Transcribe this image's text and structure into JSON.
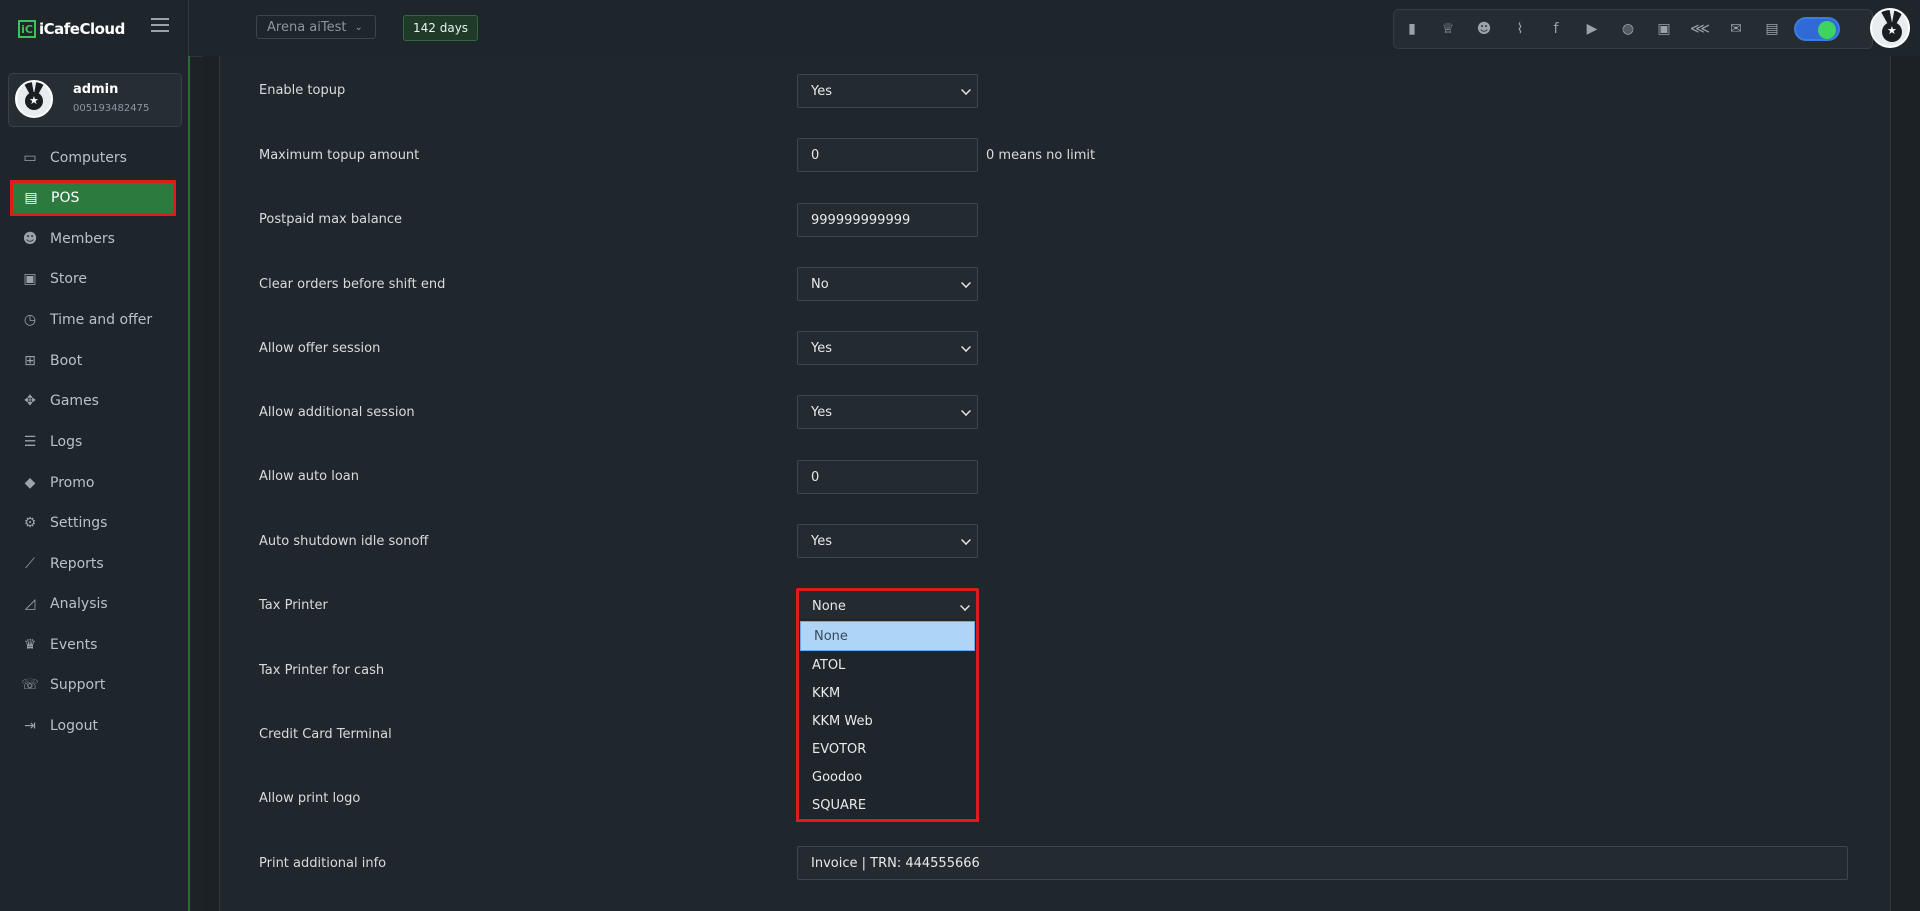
{
  "app": {
    "logo_text": "iCafeCloud",
    "logo_mark": "iC"
  },
  "user": {
    "name": "admin",
    "id": "005193482475"
  },
  "sidebar": {
    "items": [
      {
        "label": "Computers",
        "icon": "monitor-icon",
        "glyph": "▭"
      },
      {
        "label": "POS",
        "icon": "pos-icon",
        "glyph": "▤"
      },
      {
        "label": "Members",
        "icon": "members-icon",
        "glyph": "☻"
      },
      {
        "label": "Store",
        "icon": "store-icon",
        "glyph": "▣"
      },
      {
        "label": "Time and offer",
        "icon": "clock-icon",
        "glyph": "◷"
      },
      {
        "label": "Boot",
        "icon": "windows-icon",
        "glyph": "⊞"
      },
      {
        "label": "Games",
        "icon": "gamepad-icon",
        "glyph": "✥"
      },
      {
        "label": "Logs",
        "icon": "list-icon",
        "glyph": "☰"
      },
      {
        "label": "Promo",
        "icon": "tag-icon",
        "glyph": "◆"
      },
      {
        "label": "Settings",
        "icon": "gear-icon",
        "glyph": "⚙"
      },
      {
        "label": "Reports",
        "icon": "line-chart-icon",
        "glyph": "⟋"
      },
      {
        "label": "Analysis",
        "icon": "area-chart-icon",
        "glyph": "◿"
      },
      {
        "label": "Events",
        "icon": "crown-icon",
        "glyph": "♛"
      },
      {
        "label": "Support",
        "icon": "phone-icon",
        "glyph": "☏"
      },
      {
        "label": "Logout",
        "icon": "logout-icon",
        "glyph": "⇥"
      }
    ]
  },
  "topbar": {
    "cafe_name": "Arena aiTest",
    "days_left": "142 days",
    "icons": [
      "leaderboard-icon",
      "trophy-icon",
      "group-icon",
      "rss-icon",
      "facebook-icon",
      "youtube-icon",
      "globe-icon",
      "icafe-icon",
      "handshake-icon",
      "mail-icon",
      "chat-icon"
    ]
  },
  "settings": {
    "rows": [
      {
        "label": "Enable topup",
        "type": "select",
        "value": "Yes"
      },
      {
        "label": "Maximum topup amount",
        "type": "input",
        "value": "0",
        "hint": "0 means no limit"
      },
      {
        "label": "Postpaid max balance",
        "type": "input",
        "value": "999999999999"
      },
      {
        "label": "Clear orders before shift end",
        "type": "select",
        "value": "No"
      },
      {
        "label": "Allow offer session",
        "type": "select",
        "value": "Yes"
      },
      {
        "label": "Allow additional session",
        "type": "select",
        "value": "Yes"
      },
      {
        "label": "Allow auto loan",
        "type": "input",
        "value": "0"
      },
      {
        "label": "Auto shutdown idle sonoff",
        "type": "select",
        "value": "Yes"
      },
      {
        "label": "Tax Printer",
        "type": "select",
        "value": "None"
      },
      {
        "label": "Tax Printer for cash",
        "type": "select",
        "value": ""
      },
      {
        "label": "Credit Card Terminal",
        "type": "select",
        "value": ""
      },
      {
        "label": "Allow print logo",
        "type": "select",
        "value": ""
      },
      {
        "label": "Print additional info",
        "type": "input",
        "value": "Invoice | TRN: 444555666"
      }
    ],
    "tax_printer_options": [
      "None",
      "ATOL",
      "KKM",
      "KKM Web",
      "EVOTOR",
      "Goodoo",
      "SQUARE"
    ],
    "tax_printer_selected": "None"
  }
}
